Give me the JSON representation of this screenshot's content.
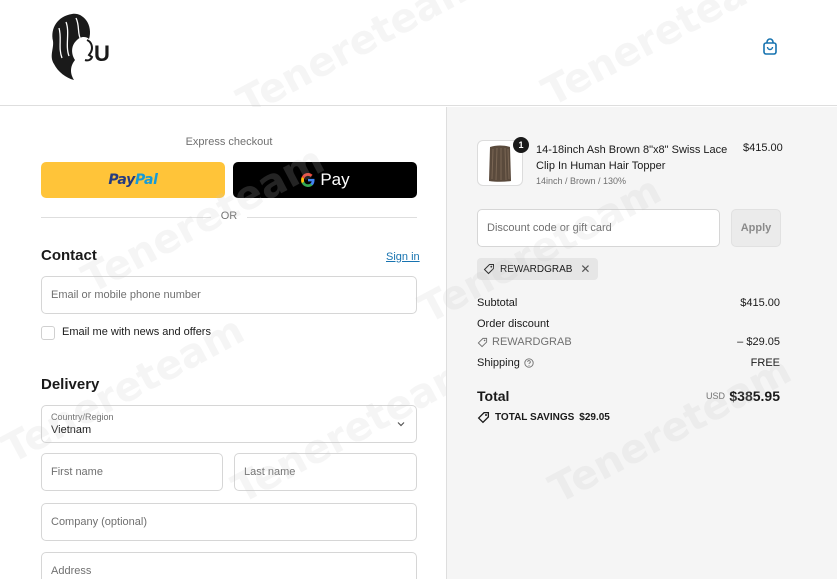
{
  "header": {
    "logo_letter": "U",
    "cart_icon": "shopping-bag-icon"
  },
  "express": {
    "label": "Express checkout",
    "paypal_part1": "Pay",
    "paypal_part2": "Pal",
    "gpay_label": "Pay",
    "or_label": "OR"
  },
  "contact": {
    "title": "Contact",
    "sign_in": "Sign in",
    "email_placeholder": "Email or mobile phone number",
    "newsletter_label": "Email me with news and offers"
  },
  "delivery": {
    "title": "Delivery",
    "country_label": "Country/Region",
    "country_value": "Vietnam",
    "first_name_placeholder": "First name",
    "last_name_placeholder": "Last name",
    "company_placeholder": "Company (optional)",
    "address_placeholder": "Address"
  },
  "order": {
    "item": {
      "quantity": "1",
      "name": "14-18inch Ash Brown 8\"x8\" Swiss Lace Clip In Human Hair Topper",
      "variant": "14inch / Brown / 130%",
      "price": "$415.00"
    },
    "discount_placeholder": "Discount code or gift card",
    "apply_label": "Apply",
    "applied_code": "REWARDGRAB",
    "subtotal_label": "Subtotal",
    "subtotal_value": "$415.00",
    "order_discount_label": "Order discount",
    "discount_code": "REWARDGRAB",
    "discount_value": "– $29.05",
    "shipping_label": "Shipping",
    "shipping_value": "FREE",
    "total_label": "Total",
    "total_currency": "USD",
    "total_value": "$385.95",
    "savings_label": "TOTAL SAVINGS",
    "savings_value": "$29.05"
  },
  "colors": {
    "paypal_yellow": "#ffc439",
    "link_blue": "#1773b0",
    "sidebar_bg": "#f5f5f5"
  }
}
